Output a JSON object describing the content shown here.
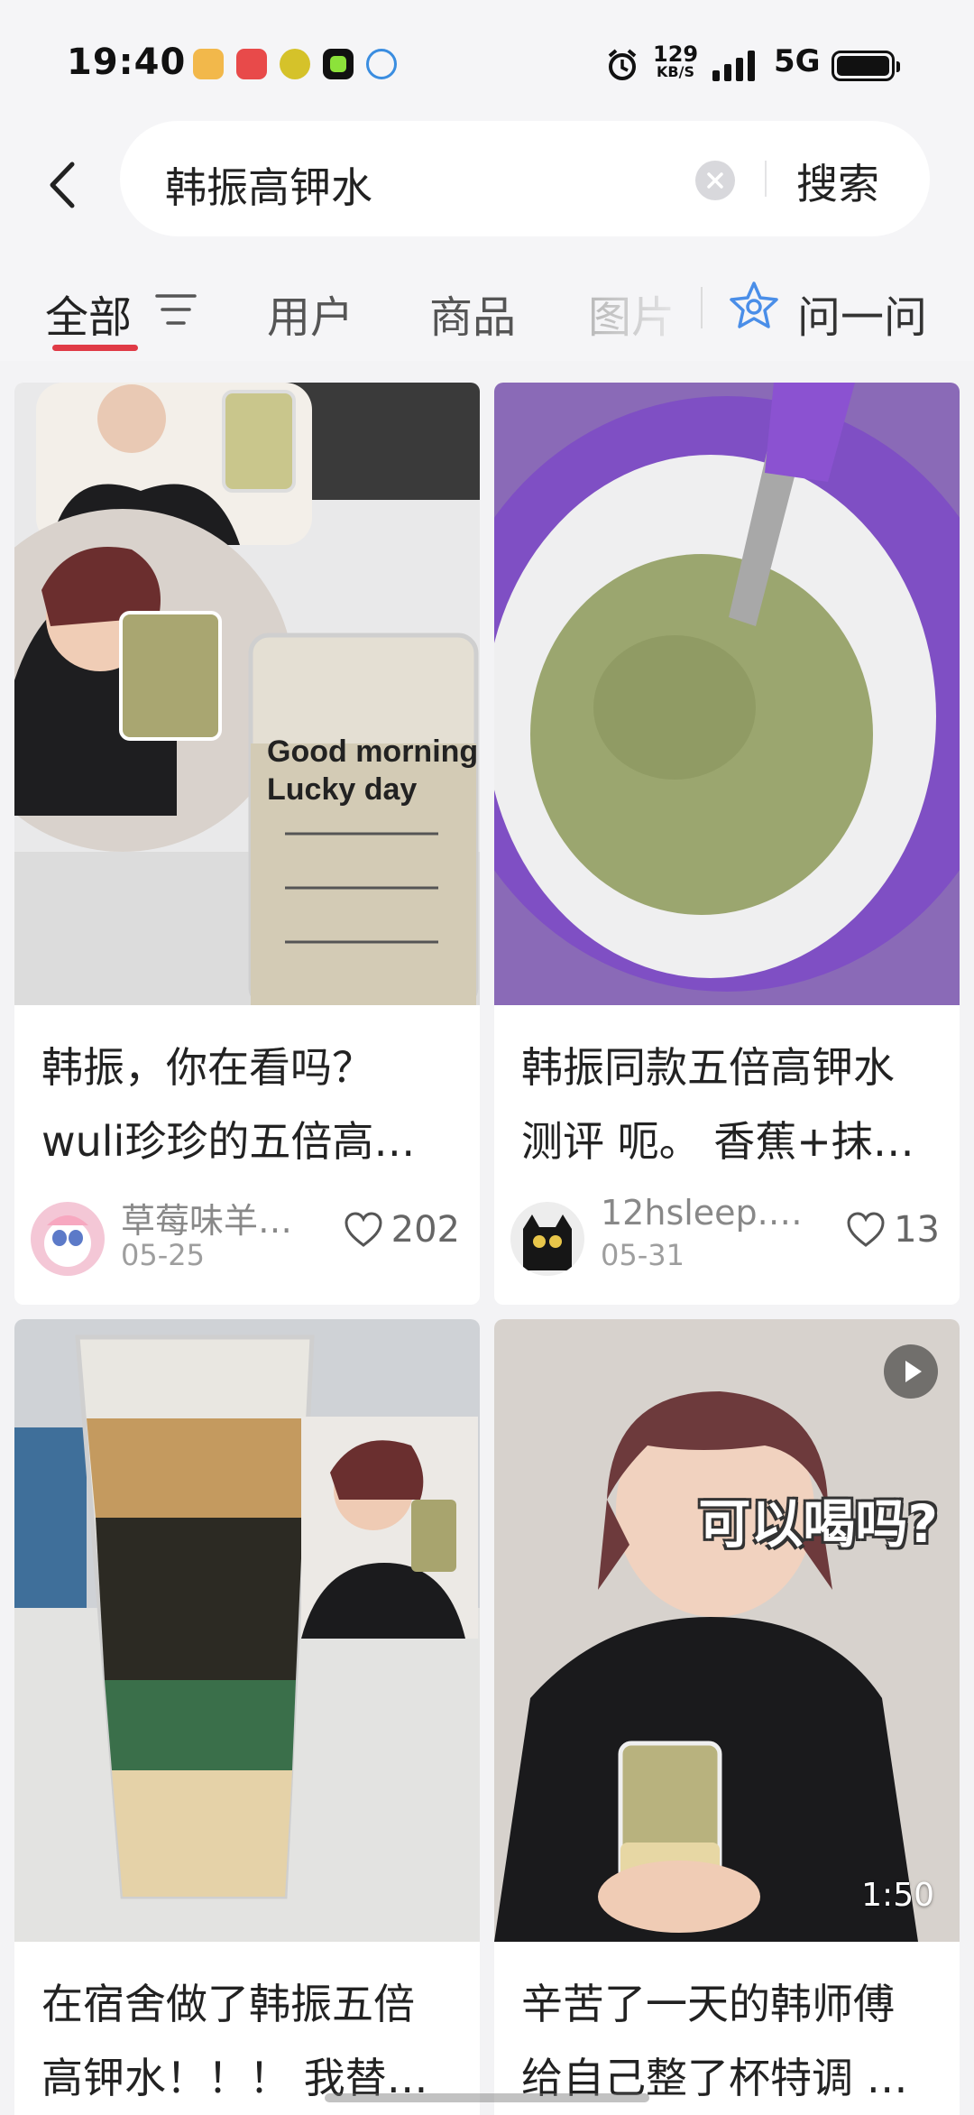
{
  "status_bar": {
    "time": "19:40",
    "net_speed_top": "129",
    "net_speed_bottom": "KB/S",
    "network": "5G"
  },
  "search": {
    "query": "韩振高钾水",
    "button_label": "搜索"
  },
  "tabs": [
    {
      "label": "全部",
      "active": true
    },
    {
      "label": "用户",
      "active": false
    },
    {
      "label": "商品",
      "active": false
    },
    {
      "label": "图片",
      "active": false
    },
    {
      "label": "问一问",
      "active": false
    }
  ],
  "feed": [
    {
      "title_line1": "韩振，你在看吗？",
      "title_line2": "wuli珍珍的五倍高…",
      "author": "草莓味羊…",
      "date": "05-25",
      "likes": "202",
      "image": {
        "cup_text_1": "Good morning",
        "cup_text_2": "Lucky day"
      }
    },
    {
      "title_line1": "韩振同款五倍高钾水",
      "title_line2": "测评 呃。 香蕉+抹…",
      "author": "12hsleep.…",
      "date": "05-31",
      "likes": "13"
    },
    {
      "title_line1": "在宿舍做了韩振五倍",
      "title_line2": "高钾水！！！ 我替…"
    },
    {
      "title_line1": "辛苦了一天的韩师傅",
      "title_line2": "给自己整了杯特调 …",
      "video_duration": "1:50",
      "overlay_text": "可以喝吗?"
    }
  ],
  "colors": {
    "accent": "#e03a46",
    "background": "#f3f3f5",
    "ask_icon": "#4a8ee8"
  }
}
